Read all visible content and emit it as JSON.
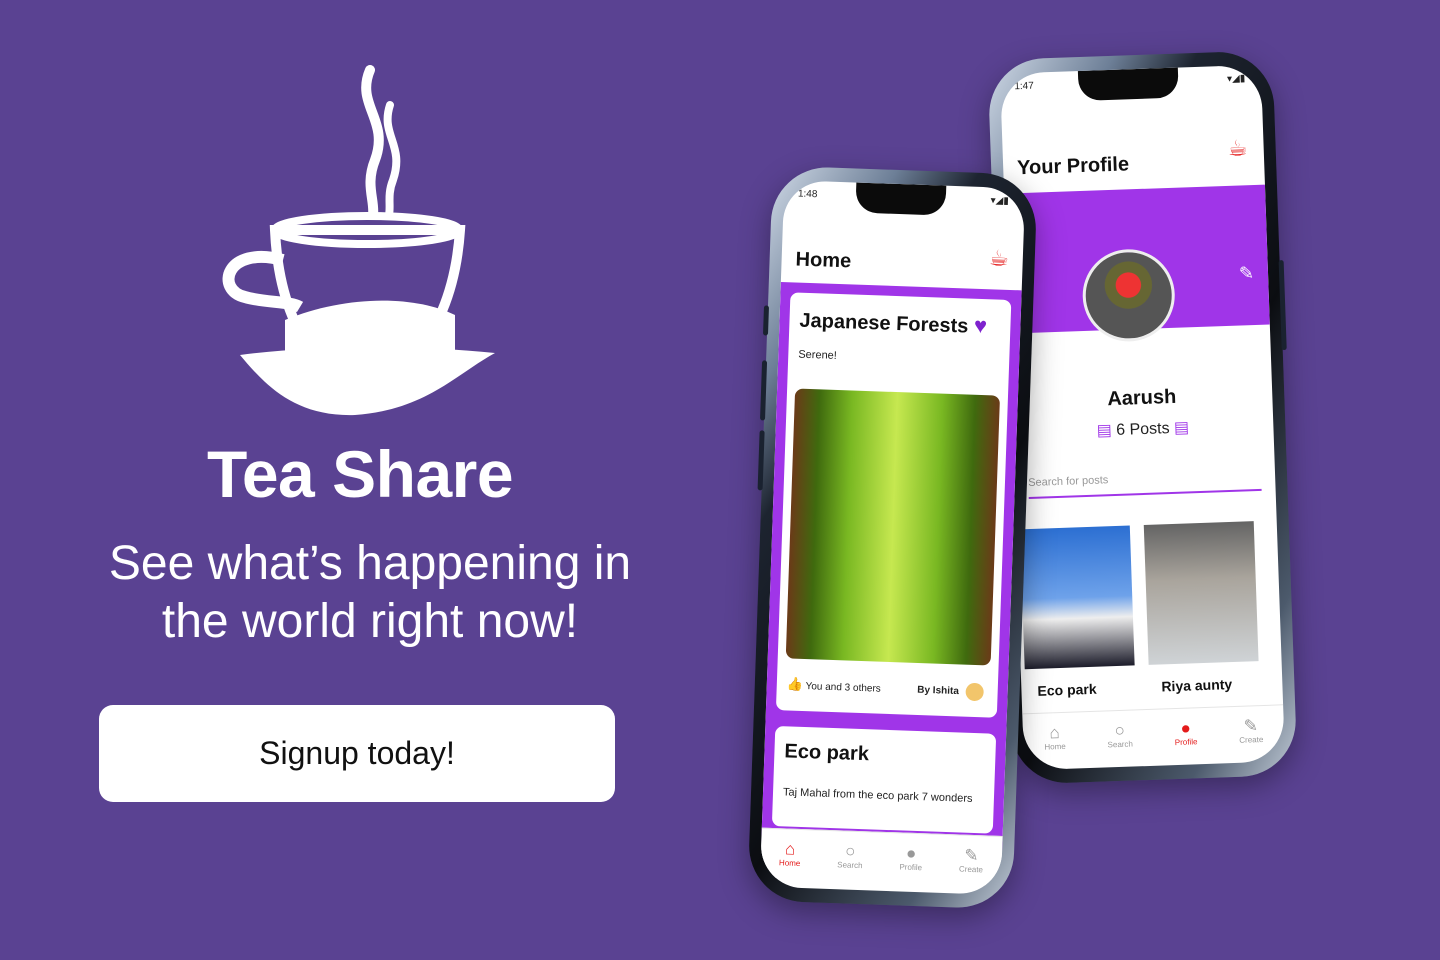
{
  "app": {
    "title": "Tea Share",
    "tagline_line1": "See what’s happening in",
    "tagline_line2": "the world right  now!",
    "cta_label": "Signup today!"
  },
  "profile_screen": {
    "status_time": "1:47",
    "header_title": "Your Profile",
    "user_name": "Aarush",
    "posts_count": "6 Posts",
    "search_placeholder": "Search for posts",
    "posts": [
      {
        "caption": "Eco park"
      },
      {
        "caption": "Riya aunty"
      }
    ],
    "nav": [
      {
        "label": "Home",
        "icon": "home-icon"
      },
      {
        "label": "Search",
        "icon": "search-icon"
      },
      {
        "label": "Profile",
        "icon": "profile-icon",
        "active": true
      },
      {
        "label": "Create",
        "icon": "create-icon"
      }
    ]
  },
  "home_screen": {
    "status_time": "1:48",
    "header_title": "Home",
    "post1": {
      "title": "Japanese Forests",
      "subtitle": "Serene!",
      "likes": "You and 3 others",
      "author": "By Ishita"
    },
    "post2": {
      "title": "Eco park",
      "subtitle": "Taj Mahal from the eco park 7 wonders"
    },
    "nav": [
      {
        "label": "Home",
        "icon": "home-icon",
        "active": true
      },
      {
        "label": "Search",
        "icon": "search-icon"
      },
      {
        "label": "Profile",
        "icon": "profile-icon"
      },
      {
        "label": "Create",
        "icon": "create-icon"
      }
    ]
  },
  "colors": {
    "background": "#5a4292",
    "accent_purple": "#a035e8",
    "active_red": "#e41b1b"
  }
}
